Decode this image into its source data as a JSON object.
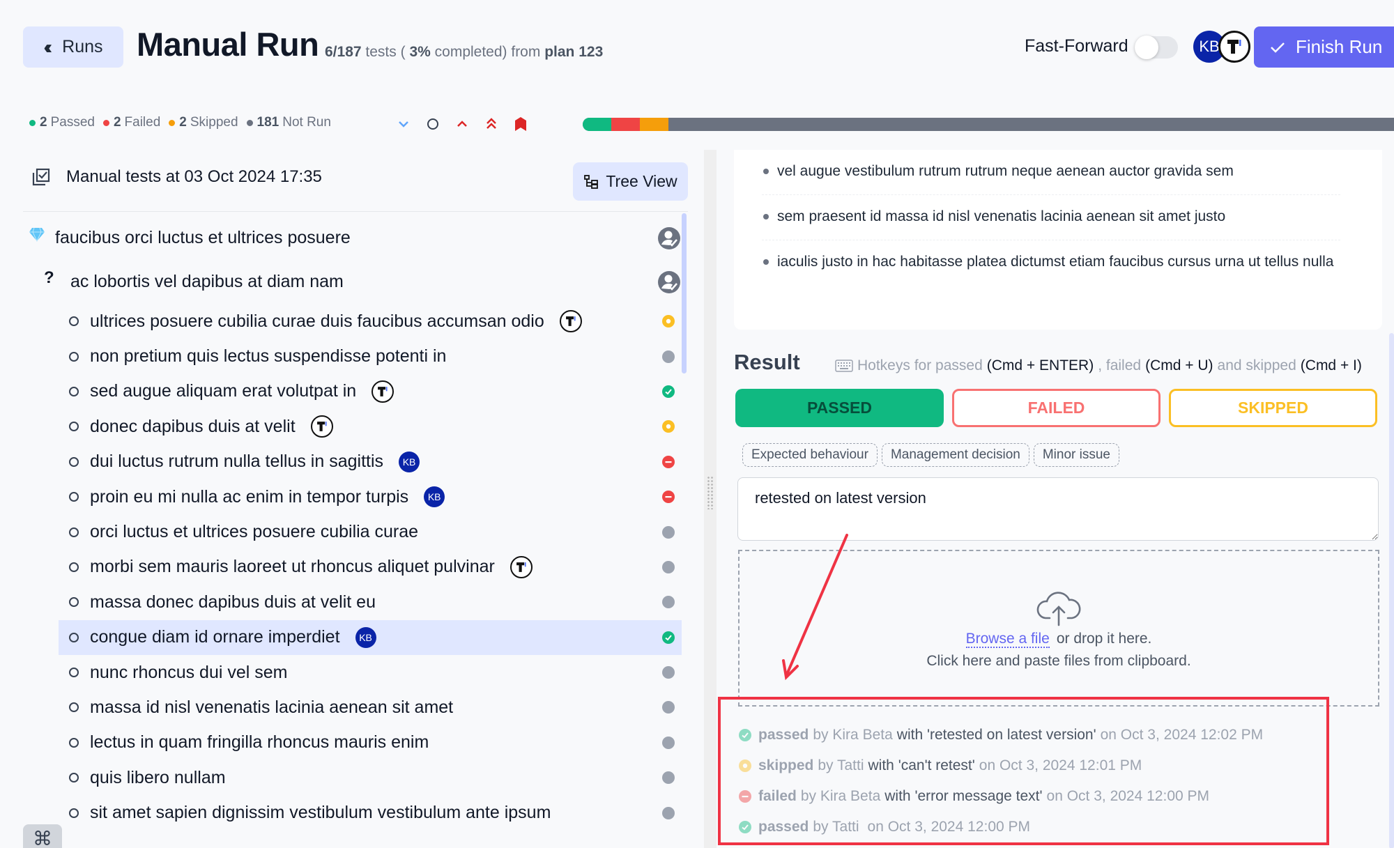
{
  "header": {
    "back_label": "Runs",
    "title": "Manual Run",
    "subtitle": {
      "progress": "6/187",
      "tests_text": "tests (",
      "percent": "3%",
      "completed_text": "completed) from",
      "plan": "plan 123"
    },
    "fast_forward_label": "Fast-Forward",
    "fast_forward_on": false,
    "avatars": [
      "KB",
      "T"
    ],
    "finish_label": "Finish Run"
  },
  "colors": {
    "passed": "#10b981",
    "failed": "#ef4444",
    "skipped": "#f59e0b",
    "not_run": "#6b7280",
    "accent": "#6366f1",
    "kb_avatar": "#0a24a8"
  },
  "stats": [
    {
      "count": "2",
      "label": "Passed",
      "color": "#10b981"
    },
    {
      "count": "2",
      "label": "Failed",
      "color": "#ef4444"
    },
    {
      "count": "2",
      "label": "Skipped",
      "color": "#f59e0b"
    },
    {
      "count": "181",
      "label": "Not Run",
      "color": "#6b7280"
    }
  ],
  "progress": {
    "total": 187,
    "passed": 2,
    "failed": 2,
    "skipped": 2,
    "not_run": 181
  },
  "priority_filters": [
    "low-priority-icon",
    "normal-priority-icon",
    "high-priority-icon",
    "highest-priority-icon",
    "critical-priority-icon"
  ],
  "left": {
    "heading": "Manual tests at 03 Oct 2024 17:35",
    "tree_view_label": "Tree View",
    "suites": [
      {
        "label": "faucibus orci luctus et ultrices posuere",
        "icon": "gem-icon"
      },
      {
        "label": "ac lobortis vel dapibus at diam nam",
        "icon": "question-icon"
      }
    ],
    "tests": [
      {
        "label": "ultrices posuere cubilia curae duis faucibus accumsan odio",
        "assignee": "T",
        "status": "skipped"
      },
      {
        "label": "non pretium quis lectus suspendisse potenti in",
        "assignee": "",
        "status": "not_run"
      },
      {
        "label": "sed augue aliquam erat volutpat in",
        "assignee": "T",
        "status": "passed"
      },
      {
        "label": "donec dapibus duis at velit",
        "assignee": "T",
        "status": "skipped"
      },
      {
        "label": "dui luctus rutrum nulla tellus in sagittis",
        "assignee": "KB",
        "status": "failed"
      },
      {
        "label": "proin eu mi nulla ac enim in tempor turpis",
        "assignee": "KB",
        "status": "failed"
      },
      {
        "label": "orci luctus et ultrices posuere cubilia curae",
        "assignee": "",
        "status": "not_run"
      },
      {
        "label": "morbi sem mauris laoreet ut rhoncus aliquet pulvinar",
        "assignee": "T",
        "status": "not_run"
      },
      {
        "label": "massa donec dapibus duis at velit eu",
        "assignee": "",
        "status": "not_run"
      },
      {
        "label": "congue diam id ornare imperdiet",
        "assignee": "KB",
        "status": "passed",
        "selected": true
      },
      {
        "label": "nunc rhoncus dui vel sem",
        "assignee": "",
        "status": "not_run"
      },
      {
        "label": "massa id nisl venenatis lacinia aenean sit amet",
        "assignee": "",
        "status": "not_run"
      },
      {
        "label": "lectus in quam fringilla rhoncus mauris enim",
        "assignee": "",
        "status": "not_run"
      },
      {
        "label": "quis libero nullam",
        "assignee": "",
        "status": "not_run"
      },
      {
        "label": "sit amet sapien dignissim vestibulum vestibulum ante ipsum",
        "assignee": "",
        "status": "not_run"
      }
    ],
    "cmd_button": "⌘"
  },
  "right": {
    "description_items": [
      "vel augue vestibulum rutrum rutrum neque aenean auctor gravida sem",
      "sem praesent id massa id nisl venenatis lacinia aenean sit amet justo",
      "iaculis justo in hac habitasse platea dictumst etiam faucibus cursus urna ut tellus nulla"
    ],
    "result_title": "Result",
    "hotkeys": {
      "prefix": "Hotkeys for passed",
      "passed_key": "(Cmd + ENTER)",
      "failed_text": ", failed",
      "failed_key": "(Cmd + U)",
      "skipped_text": "and skipped",
      "skipped_key": "(Cmd + I)"
    },
    "buttons": {
      "passed": "PASSED",
      "failed": "FAILED",
      "skipped": "SKIPPED"
    },
    "chips": [
      "Expected behaviour",
      "Management decision",
      "Minor issue"
    ],
    "comment_value": "retested on latest version",
    "dropzone": {
      "browse_link": "Browse a file",
      "drop_text": "or drop it here.",
      "paste_text": "Click here and paste files from clipboard."
    },
    "history": [
      {
        "status": "passed",
        "by": "by Kira Beta",
        "with": "with 'retested on latest version'",
        "on": "on Oct 3, 2024 12:02 PM"
      },
      {
        "status": "skipped",
        "by": "by Tatti",
        "with": "with 'can't retest'",
        "on": "on Oct 3, 2024 12:01 PM"
      },
      {
        "status": "failed",
        "by": "by Kira Beta",
        "with": "with 'error message text'",
        "on": "on Oct 3, 2024 12:00 PM"
      },
      {
        "status": "passed",
        "by": "by Tatti",
        "with": "",
        "on": "on Oct 3, 2024 12:00 PM"
      }
    ]
  }
}
